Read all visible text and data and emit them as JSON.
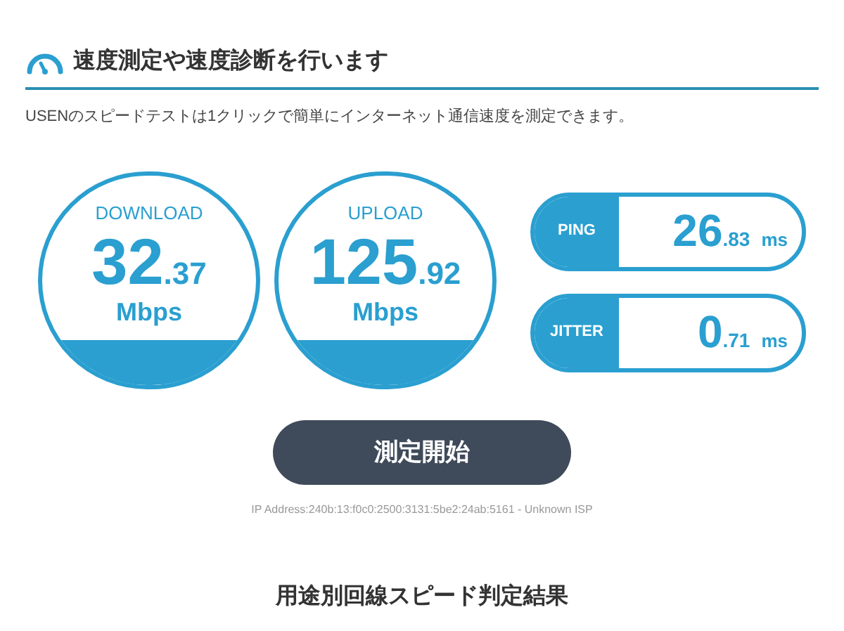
{
  "header": {
    "title": "速度測定や速度診断を行います",
    "description": "USENのスピードテストは1クリックで簡単にインターネット通信速度を測定できます。"
  },
  "speeds": [
    {
      "label": "DOWNLOAD",
      "integer": "32",
      "decimal": ".37",
      "unit": "Mbps"
    },
    {
      "label": "UPLOAD",
      "integer": "125",
      "decimal": ".92",
      "unit": "Mbps"
    }
  ],
  "latency": [
    {
      "label": "PING",
      "integer": "26",
      "decimal": ".83",
      "unit": "ms"
    },
    {
      "label": "JITTER",
      "integer": "0",
      "decimal": ".71",
      "unit": "ms"
    }
  ],
  "start_button": "測定開始",
  "ip_info": "IP Address:240b:13:f0c0:2500:3131:5be2:24ab:5161 - Unknown ISP",
  "results_title": "用途別回線スピード判定結果"
}
